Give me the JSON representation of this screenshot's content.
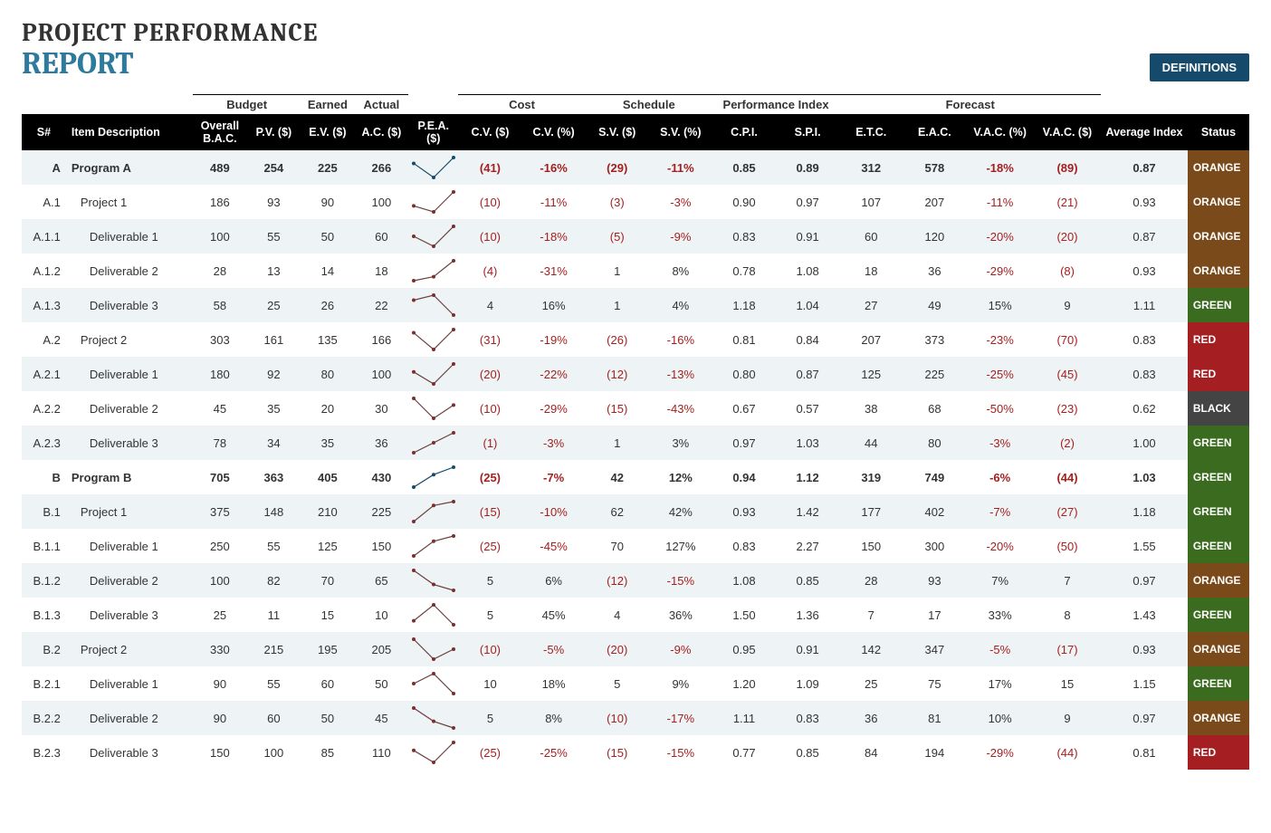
{
  "title_line1": "PROJECT PERFORMANCE",
  "title_line2": "REPORT",
  "definitions_button": "DEFINITIONS",
  "group_headers": {
    "budget": "Budget",
    "earned": "Earned",
    "actual": "Actual",
    "cost": "Cost",
    "schedule": "Schedule",
    "perf": "Performance Index",
    "forecast": "Forecast"
  },
  "columns": {
    "sn": "S#",
    "desc": "Item Description",
    "bac": "Overall\nB.A.C.",
    "pv": "P.V. ($)",
    "ev": "E.V. ($)",
    "ac": "A.C. ($)",
    "pea": "P.E.A. ($)",
    "cv": "C.V. ($)",
    "cvp": "C.V. (%)",
    "sv": "S.V. ($)",
    "svp": "S.V. (%)",
    "cpi": "C.P.I.",
    "spi": "S.P.I.",
    "etc": "E.T.C.",
    "eac": "E.A.C.",
    "vacp": "V.A.C. (%)",
    "vac": "V.A.C. ($)",
    "avg": "Average Index",
    "status": "Status"
  },
  "rows": [
    {
      "sn": "A",
      "desc": "Program A",
      "level": 0,
      "bac": 489,
      "pv": 254,
      "ev": 225,
      "ac": 266,
      "spark": [
        254,
        225,
        266
      ],
      "cv": -41,
      "cvp": -16,
      "sv": -29,
      "svp": -11,
      "cpi": 0.85,
      "spi": 0.89,
      "etc": 312,
      "eac": 578,
      "vacp": -18,
      "vac": -89,
      "avg": 0.87,
      "status": "ORANGE"
    },
    {
      "sn": "A.1",
      "desc": "Project 1",
      "level": 1,
      "bac": 186,
      "pv": 93,
      "ev": 90,
      "ac": 100,
      "spark": [
        93,
        90,
        100
      ],
      "cv": -10,
      "cvp": -11,
      "sv": -3,
      "svp": -3,
      "cpi": 0.9,
      "spi": 0.97,
      "etc": 107,
      "eac": 207,
      "vacp": -11,
      "vac": -21,
      "avg": 0.93,
      "status": "ORANGE"
    },
    {
      "sn": "A.1.1",
      "desc": "Deliverable 1",
      "level": 2,
      "bac": 100,
      "pv": 55,
      "ev": 50,
      "ac": 60,
      "spark": [
        55,
        50,
        60
      ],
      "cv": -10,
      "cvp": -18,
      "sv": -5,
      "svp": -9,
      "cpi": 0.83,
      "spi": 0.91,
      "etc": 60,
      "eac": 120,
      "vacp": -20,
      "vac": -20,
      "avg": 0.87,
      "status": "ORANGE"
    },
    {
      "sn": "A.1.2",
      "desc": "Deliverable 2",
      "level": 2,
      "bac": 28,
      "pv": 13,
      "ev": 14,
      "ac": 18,
      "spark": [
        13,
        14,
        18
      ],
      "cv": -4,
      "cvp": -31,
      "sv": 1,
      "svp": 8,
      "cpi": 0.78,
      "spi": 1.08,
      "etc": 18,
      "eac": 36,
      "vacp": -29,
      "vac": -8,
      "avg": 0.93,
      "status": "ORANGE"
    },
    {
      "sn": "A.1.3",
      "desc": "Deliverable 3",
      "level": 2,
      "bac": 58,
      "pv": 25,
      "ev": 26,
      "ac": 22,
      "spark": [
        25,
        26,
        22
      ],
      "cv": 4,
      "cvp": 16,
      "sv": 1,
      "svp": 4,
      "cpi": 1.18,
      "spi": 1.04,
      "etc": 27,
      "eac": 49,
      "vacp": 15,
      "vac": 9,
      "avg": 1.11,
      "status": "GREEN"
    },
    {
      "sn": "A.2",
      "desc": "Project 2",
      "level": 1,
      "bac": 303,
      "pv": 161,
      "ev": 135,
      "ac": 166,
      "spark": [
        161,
        135,
        166
      ],
      "cv": -31,
      "cvp": -19,
      "sv": -26,
      "svp": -16,
      "cpi": 0.81,
      "spi": 0.84,
      "etc": 207,
      "eac": 373,
      "vacp": -23,
      "vac": -70,
      "avg": 0.83,
      "status": "RED"
    },
    {
      "sn": "A.2.1",
      "desc": "Deliverable 1",
      "level": 2,
      "bac": 180,
      "pv": 92,
      "ev": 80,
      "ac": 100,
      "spark": [
        92,
        80,
        100
      ],
      "cv": -20,
      "cvp": -22,
      "sv": -12,
      "svp": -13,
      "cpi": 0.8,
      "spi": 0.87,
      "etc": 125,
      "eac": 225,
      "vacp": -25,
      "vac": -45,
      "avg": 0.83,
      "status": "RED"
    },
    {
      "sn": "A.2.2",
      "desc": "Deliverable 2",
      "level": 2,
      "bac": 45,
      "pv": 35,
      "ev": 20,
      "ac": 30,
      "spark": [
        35,
        20,
        30
      ],
      "cv": -10,
      "cvp": -29,
      "sv": -15,
      "svp": -43,
      "cpi": 0.67,
      "spi": 0.57,
      "etc": 38,
      "eac": 68,
      "vacp": -50,
      "vac": -23,
      "avg": 0.62,
      "status": "BLACK"
    },
    {
      "sn": "A.2.3",
      "desc": "Deliverable 3",
      "level": 2,
      "bac": 78,
      "pv": 34,
      "ev": 35,
      "ac": 36,
      "spark": [
        34,
        35,
        36
      ],
      "cv": -1,
      "cvp": -3,
      "sv": 1,
      "svp": 3,
      "cpi": 0.97,
      "spi": 1.03,
      "etc": 44,
      "eac": 80,
      "vacp": -3,
      "vac": -2,
      "avg": 1.0,
      "status": "GREEN"
    },
    {
      "sn": "B",
      "desc": "Program B",
      "level": 0,
      "bac": 705,
      "pv": 363,
      "ev": 405,
      "ac": 430,
      "spark": [
        363,
        405,
        430
      ],
      "cv": -25,
      "cvp": -7,
      "sv": 42,
      "svp": 12,
      "cpi": 0.94,
      "spi": 1.12,
      "etc": 319,
      "eac": 749,
      "vacp": -6,
      "vac": -44,
      "avg": 1.03,
      "status": "GREEN"
    },
    {
      "sn": "B.1",
      "desc": "Project 1",
      "level": 1,
      "bac": 375,
      "pv": 148,
      "ev": 210,
      "ac": 225,
      "spark": [
        148,
        210,
        225
      ],
      "cv": -15,
      "cvp": -10,
      "sv": 62,
      "svp": 42,
      "cpi": 0.93,
      "spi": 1.42,
      "etc": 177,
      "eac": 402,
      "vacp": -7,
      "vac": -27,
      "avg": 1.18,
      "status": "GREEN"
    },
    {
      "sn": "B.1.1",
      "desc": "Deliverable 1",
      "level": 2,
      "bac": 250,
      "pv": 55,
      "ev": 125,
      "ac": 150,
      "spark": [
        55,
        125,
        150
      ],
      "cv": -25,
      "cvp": -45,
      "sv": 70,
      "svp": 127,
      "cpi": 0.83,
      "spi": 2.27,
      "etc": 150,
      "eac": 300,
      "vacp": -20,
      "vac": -50,
      "avg": 1.55,
      "status": "GREEN"
    },
    {
      "sn": "B.1.2",
      "desc": "Deliverable 2",
      "level": 2,
      "bac": 100,
      "pv": 82,
      "ev": 70,
      "ac": 65,
      "spark": [
        82,
        70,
        65
      ],
      "cv": 5,
      "cvp": 6,
      "sv": -12,
      "svp": -15,
      "cpi": 1.08,
      "spi": 0.85,
      "etc": 28,
      "eac": 93,
      "vacp": 7,
      "vac": 7,
      "avg": 0.97,
      "status": "ORANGE"
    },
    {
      "sn": "B.1.3",
      "desc": "Deliverable 3",
      "level": 2,
      "bac": 25,
      "pv": 11,
      "ev": 15,
      "ac": 10,
      "spark": [
        11,
        15,
        10
      ],
      "cv": 5,
      "cvp": 45,
      "sv": 4,
      "svp": 36,
      "cpi": 1.5,
      "spi": 1.36,
      "etc": 7,
      "eac": 17,
      "vacp": 33,
      "vac": 8,
      "avg": 1.43,
      "status": "GREEN"
    },
    {
      "sn": "B.2",
      "desc": "Project 2",
      "level": 1,
      "bac": 330,
      "pv": 215,
      "ev": 195,
      "ac": 205,
      "spark": [
        215,
        195,
        205
      ],
      "cv": -10,
      "cvp": -5,
      "sv": -20,
      "svp": -9,
      "cpi": 0.95,
      "spi": 0.91,
      "etc": 142,
      "eac": 347,
      "vacp": -5,
      "vac": -17,
      "avg": 0.93,
      "status": "ORANGE"
    },
    {
      "sn": "B.2.1",
      "desc": "Deliverable 1",
      "level": 2,
      "bac": 90,
      "pv": 55,
      "ev": 60,
      "ac": 50,
      "spark": [
        55,
        60,
        50
      ],
      "cv": 10,
      "cvp": 18,
      "sv": 5,
      "svp": 9,
      "cpi": 1.2,
      "spi": 1.09,
      "etc": 25,
      "eac": 75,
      "vacp": 17,
      "vac": 15,
      "avg": 1.15,
      "status": "GREEN"
    },
    {
      "sn": "B.2.2",
      "desc": "Deliverable 2",
      "level": 2,
      "bac": 90,
      "pv": 60,
      "ev": 50,
      "ac": 45,
      "spark": [
        60,
        50,
        45
      ],
      "cv": 5,
      "cvp": 8,
      "sv": -10,
      "svp": -17,
      "cpi": 1.11,
      "spi": 0.83,
      "etc": 36,
      "eac": 81,
      "vacp": 10,
      "vac": 9,
      "avg": 0.97,
      "status": "ORANGE"
    },
    {
      "sn": "B.2.3",
      "desc": "Deliverable 3",
      "level": 2,
      "bac": 150,
      "pv": 100,
      "ev": 85,
      "ac": 110,
      "spark": [
        100,
        85,
        110
      ],
      "cv": -25,
      "cvp": -25,
      "sv": -15,
      "svp": -15,
      "cpi": 0.77,
      "spi": 0.85,
      "etc": 84,
      "eac": 194,
      "vacp": -29,
      "vac": -44,
      "avg": 0.81,
      "status": "RED"
    }
  ]
}
